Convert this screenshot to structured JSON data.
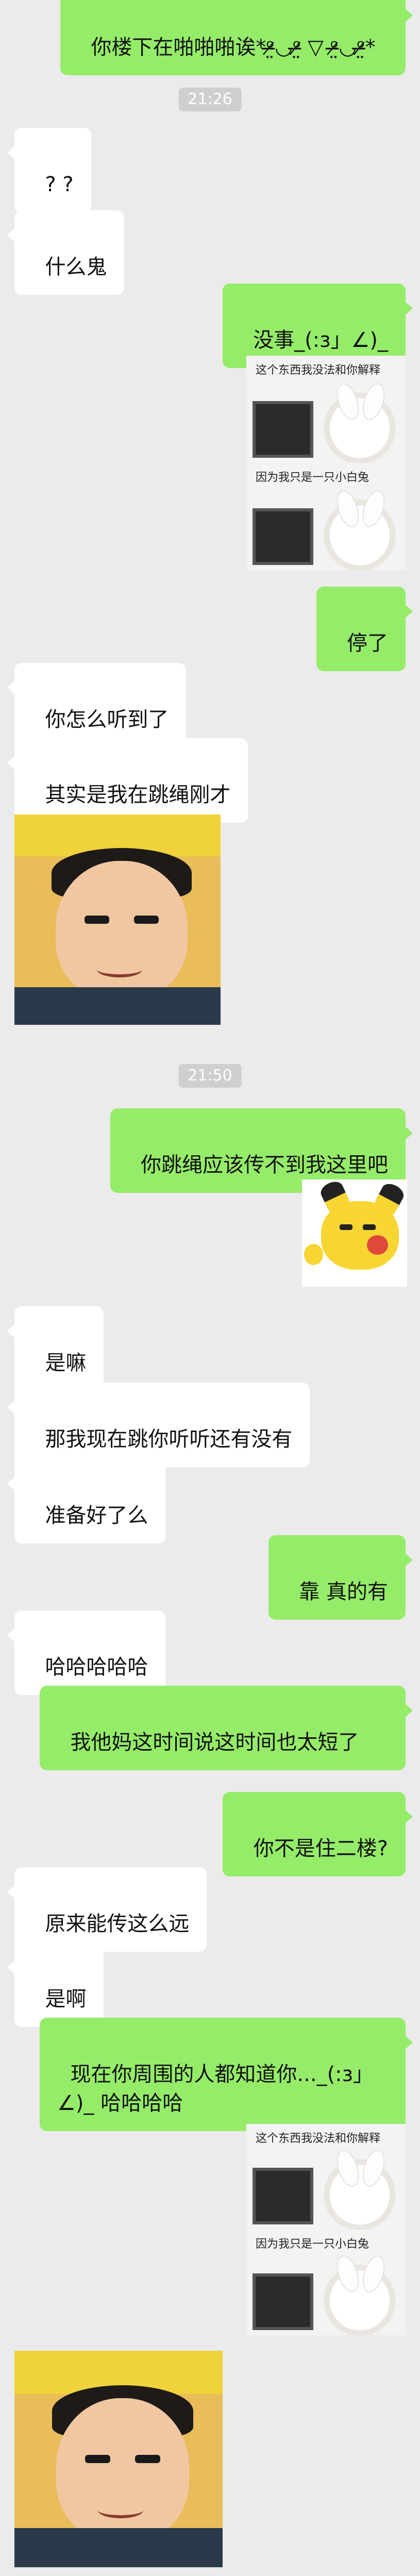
{
  "messages": {
    "m0": "你楼下在啪啪啪诶*ᵒ̶̷̤◡ᵒ̶̷̤ ▽ ᵒ̶̷̤◡ᵒ̶̷̤*",
    "t1": "21:26",
    "m1": "? ?",
    "m2": "什么鬼",
    "m3": "没事_(:з」∠)_",
    "m4": "停了",
    "m5": "你怎么听到了",
    "m6": "其实是我在跳绳刚才",
    "t2": "21:50",
    "m7": "你跳绳应该传不到我这里吧",
    "m8": "是嘛",
    "m9": "那我现在跳你听听还有没有",
    "m10": "准备好了么",
    "m11": "靠 真的有",
    "m12": "哈哈哈哈哈",
    "m13": "我他妈这时间说这时间也太短了",
    "m14": "你不是住二楼?",
    "m15": "原来能传这么远",
    "m16": "是啊",
    "m17": "现在你周围的人都知道你..._(:з」∠)_ 哈哈哈哈"
  },
  "stickers": {
    "bunny_top_caption": "这个东西我没法和你解释",
    "bunny_bottom_caption": "因为我只是一只小白兔"
  },
  "colors": {
    "background": "#ebebeb",
    "incoming_bubble": "#ffffff",
    "outgoing_bubble": "#95ec69",
    "timestamp_bg": "#cfcfcf"
  }
}
